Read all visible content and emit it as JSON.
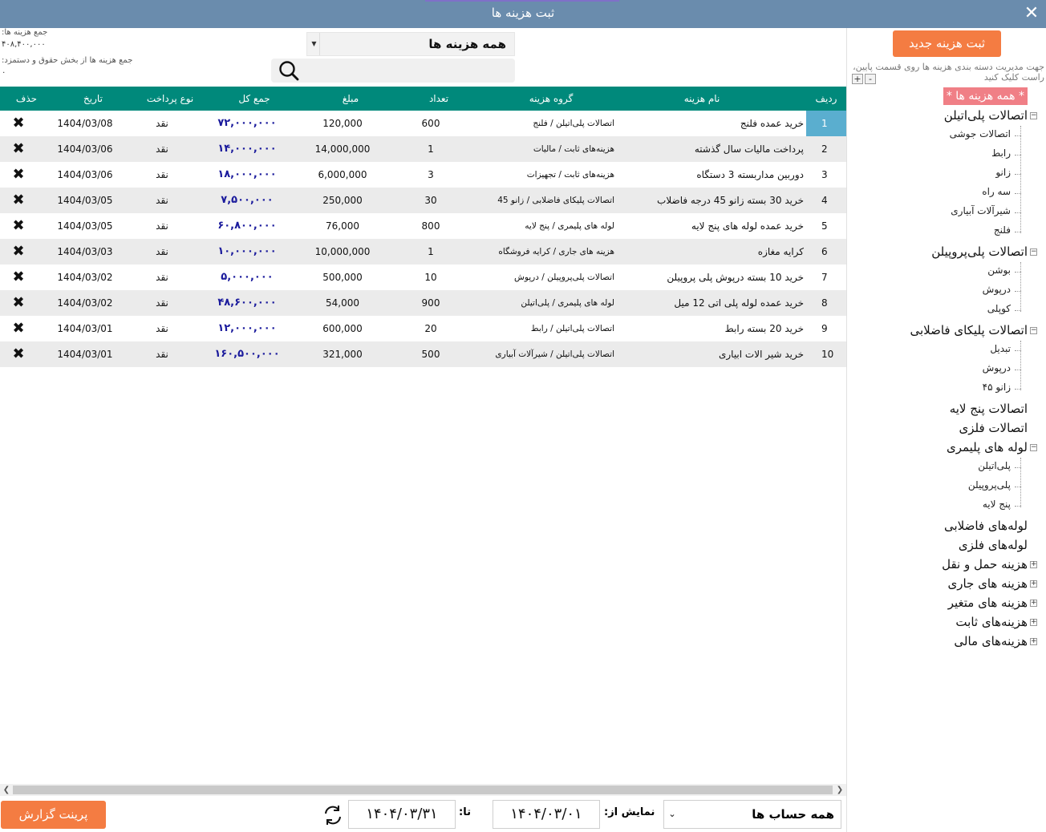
{
  "window": {
    "title": "ثبت هزینه ها",
    "close_icon": "close-icon"
  },
  "summary": {
    "total_label": "جمع هزینه ها:",
    "total_value": "۴۰۸,۴۰۰,۰۰۰",
    "salary_label": "جمع هزینه ها از بخش حقوق و دستمزد:",
    "salary_value": "۰"
  },
  "filters": {
    "category_value": "همه هزینه ها",
    "search_placeholder": ""
  },
  "sidebar": {
    "new_expense_label": "ثبت هزینه جدید",
    "hint": "جهت مدیریت دسته بندی هزینه ها روی قسمت پایین، راست کلیک کنید",
    "expand_all": "+",
    "collapse_all": "-",
    "tree_root": "* همه هزینه ها *",
    "tree": [
      {
        "label": "اتصالات پلی‌اتیلن",
        "expander": "−",
        "children": [
          "اتصالات جوشی",
          "رابط",
          "زانو",
          "سه راه",
          "شیرآلات آبیاری",
          "فلنج"
        ]
      },
      {
        "label": "اتصالات پلی‌پروپیلن",
        "expander": "−",
        "children": [
          "بوشن",
          "درپوش",
          "کوپلی"
        ]
      },
      {
        "label": "اتصالات پلیکای فاضلابی",
        "expander": "−",
        "children": [
          "تبدیل",
          "درپوش",
          "زانو ۴۵"
        ]
      },
      {
        "label": "اتصالات پنج لایه",
        "expander": "",
        "children": []
      },
      {
        "label": "اتصالات فلزی",
        "expander": "",
        "children": []
      },
      {
        "label": "لوله های پلیمری",
        "expander": "−",
        "children": [
          "پلی‌اتیلن",
          "پلی‌پروپیلن",
          "پنج لایه"
        ]
      },
      {
        "label": "لوله‌های فاضلابی",
        "expander": "",
        "children": []
      },
      {
        "label": "لوله‌های فلزی",
        "expander": "",
        "children": []
      },
      {
        "label": "هزینه حمل و نقل",
        "expander": "+",
        "children": []
      },
      {
        "label": "هزینه های جاری",
        "expander": "+",
        "children": []
      },
      {
        "label": "هزینه های متغیر",
        "expander": "+",
        "children": []
      },
      {
        "label": "هزینه‌های ثابت",
        "expander": "+",
        "children": []
      },
      {
        "label": "هزینه‌های مالی",
        "expander": "+",
        "children": []
      }
    ]
  },
  "grid": {
    "columns": {
      "idx": "ردیف",
      "name": "نام هزینه",
      "group": "گروه هزینه",
      "qty": "تعداد",
      "amount": "مبلغ",
      "total": "جمع کل",
      "pay": "نوع پرداخت",
      "date": "تاریخ",
      "del": "حذف"
    },
    "rows": [
      {
        "idx": "1",
        "name": "خرید عمده فلنج",
        "group": "اتصالات پلی‌اتیلن / فلنج",
        "qty": "600",
        "amount": "120,000",
        "total": "۷۲,۰۰۰,۰۰۰",
        "pay": "نقد",
        "date": "1404/03/08",
        "del": "✖"
      },
      {
        "idx": "2",
        "name": "پرداخت مالیات سال گذشته",
        "group": "هزینه‌های ثابت / مالیات",
        "qty": "1",
        "amount": "14,000,000",
        "total": "۱۴,۰۰۰,۰۰۰",
        "pay": "نقد",
        "date": "1404/03/06",
        "del": "✖"
      },
      {
        "idx": "3",
        "name": "دوربین مداربسته 3 دستگاه",
        "group": "هزینه‌های ثابت / تجهیزات",
        "qty": "3",
        "amount": "6,000,000",
        "total": "۱۸,۰۰۰,۰۰۰",
        "pay": "نقد",
        "date": "1404/03/06",
        "del": "✖"
      },
      {
        "idx": "4",
        "name": "خرید 30 بسته زانو 45 درجه فاضلاب",
        "group": "اتصالات پلیکای فاضلابی / زانو 45",
        "qty": "30",
        "amount": "250,000",
        "total": "۷,۵۰۰,۰۰۰",
        "pay": "نقد",
        "date": "1404/03/05",
        "del": "✖"
      },
      {
        "idx": "5",
        "name": "خرید عمده لوله های پنج لایه",
        "group": "لوله های پلیمری / پنج لایه",
        "qty": "800",
        "amount": "76,000",
        "total": "۶۰,۸۰۰,۰۰۰",
        "pay": "نقد",
        "date": "1404/03/05",
        "del": "✖"
      },
      {
        "idx": "6",
        "name": "کرایه مغازه",
        "group": "هزینه های جاری / کرایه فروشگاه",
        "qty": "1",
        "amount": "10,000,000",
        "total": "۱۰,۰۰۰,۰۰۰",
        "pay": "نقد",
        "date": "1404/03/03",
        "del": "✖"
      },
      {
        "idx": "7",
        "name": "خرید 10 بسته درپوش پلی پروپیلن",
        "group": "اتصالات پلی‌پروپیلن / درپوش",
        "qty": "10",
        "amount": "500,000",
        "total": "۵,۰۰۰,۰۰۰",
        "pay": "نقد",
        "date": "1404/03/02",
        "del": "✖"
      },
      {
        "idx": "8",
        "name": "خرید عمده لوله پلی اتی 12 میل",
        "group": "لوله های پلیمری / پلی‌اتیلن",
        "qty": "900",
        "amount": "54,000",
        "total": "۴۸,۶۰۰,۰۰۰",
        "pay": "نقد",
        "date": "1404/03/02",
        "del": "✖"
      },
      {
        "idx": "9",
        "name": "خرید 20 بسته رابط",
        "group": "اتصالات پلی‌اتیلن / رابط",
        "qty": "20",
        "amount": "600,000",
        "total": "۱۲,۰۰۰,۰۰۰",
        "pay": "نقد",
        "date": "1404/03/01",
        "del": "✖"
      },
      {
        "idx": "10",
        "name": "خرید شیر الات ابیاری",
        "group": "اتصالات پلی‌اتیلن / شیرآلات آبیاری",
        "qty": "500",
        "amount": "321,000",
        "total": "۱۶۰,۵۰۰,۰۰۰",
        "pay": "نقد",
        "date": "1404/03/01",
        "del": "✖"
      }
    ]
  },
  "footer": {
    "print_label": "پرینت گزارش",
    "to_label": "تا:",
    "to_date": "۱۴۰۴/۰۳/۳۱",
    "from_label": "نمایش از:",
    "from_date": "۱۴۰۴/۰۳/۰۱",
    "account_value": "همه حساب ها"
  },
  "colors": {
    "titlebar": "#6a8cad",
    "grid_header": "#00897b",
    "accent_button": "#f47c42",
    "tree_root_bg": "#f07f86",
    "selected_row_index": "#5aaecf",
    "total_text": "#1a1a9c"
  }
}
